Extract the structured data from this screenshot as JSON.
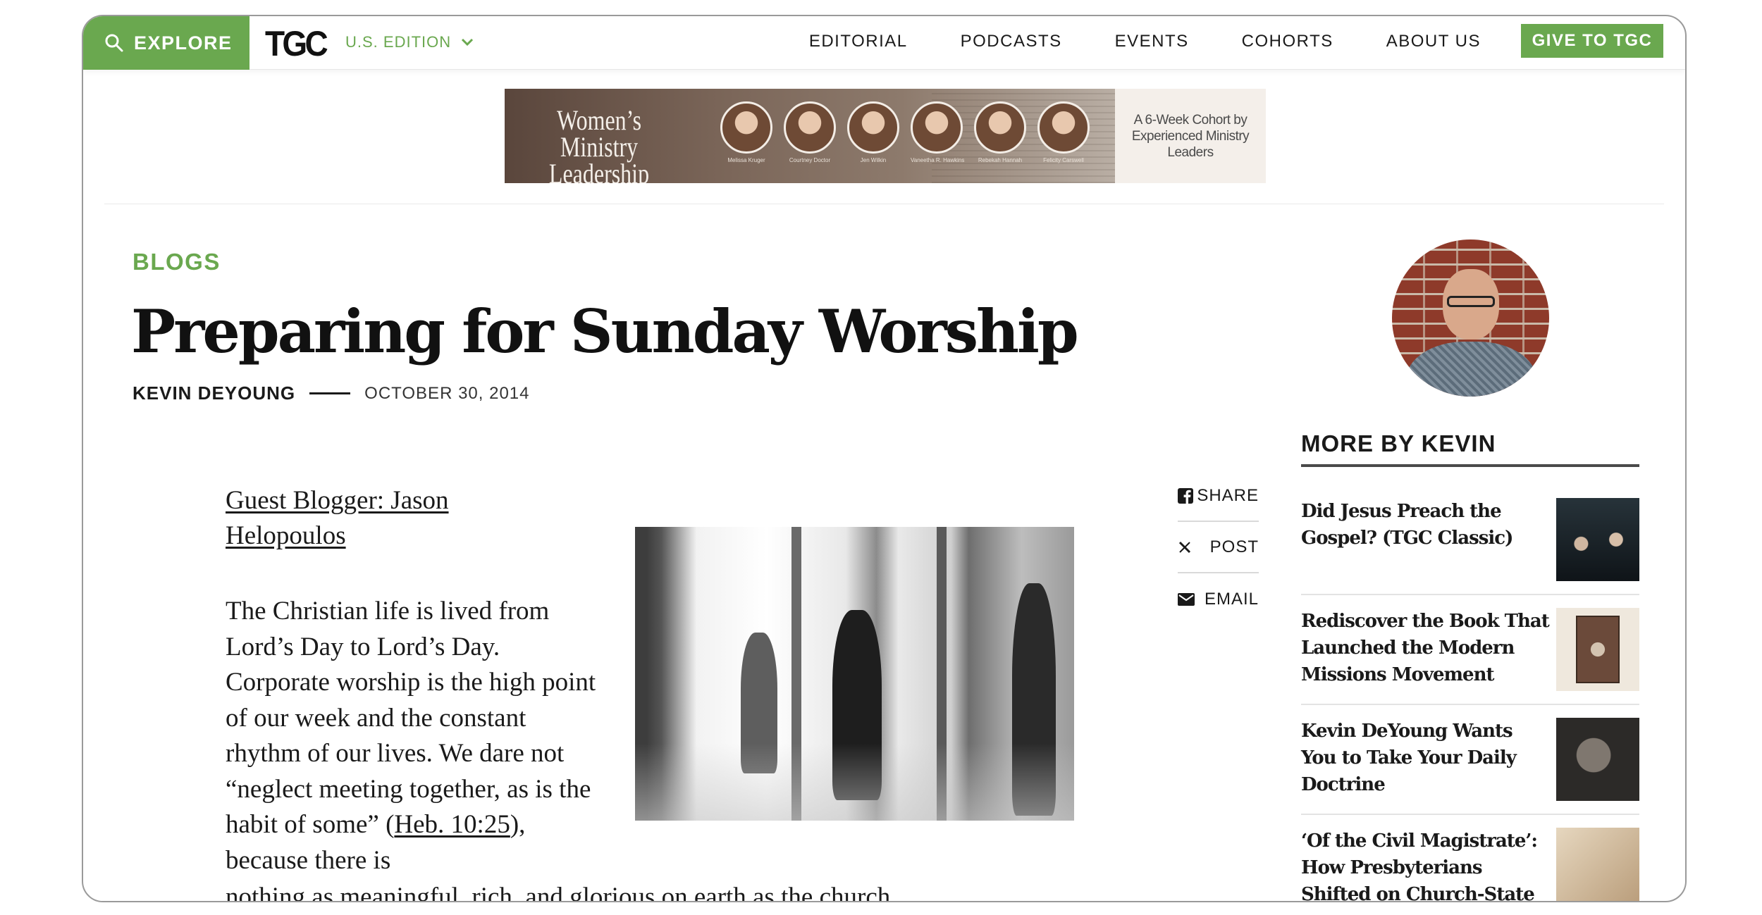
{
  "nav": {
    "explore": "EXPLORE",
    "logo": "TGC",
    "edition": "U.S. EDITION",
    "items": [
      "EDITORIAL",
      "PODCASTS",
      "EVENTS",
      "COHORTS",
      "ABOUT US"
    ],
    "give": "GIVE TO TGC"
  },
  "banner": {
    "title": "Women’s Ministry Leadership",
    "names": [
      "Melissa Kruger",
      "Courtney Doctor",
      "Jen Wilkin",
      "Vaneetha R. Hawkins",
      "Rebekah Hannah",
      "Felicity Carswell"
    ],
    "tagline": "A 6-Week Cohort by Experienced Ministry Leaders"
  },
  "article": {
    "kicker": "BLOGS",
    "title": "Preparing for Sunday Worship",
    "author": "KEVIN DEYOUNG",
    "date": "OCTOBER 30, 2014",
    "guest": "Guest Blogger: Jason Helopoulos",
    "body_before": "The Christian life is lived from Lord’s Day to Lord’s Day. Corporate worship is the high point of our week and the constant rhythm of our lives. We dare not “neglect meeting together, as is the habit of some” (",
    "body_link": "Heb. 10:25",
    "body_after": "), because there is",
    "body_last": "nothing as meaningful, rich, and glorious on earth as the church"
  },
  "share": {
    "share": "SHARE",
    "post": "POST",
    "email": "EMAIL"
  },
  "sidebar": {
    "heading": "MORE BY KEVIN",
    "items": [
      {
        "title": "Did Jesus Preach the Gospel? (TGC Classic)"
      },
      {
        "title": "Rediscover the Book That Launched the Modern Missions Movement"
      },
      {
        "title": "Kevin DeYoung Wants You to Take Your Daily Doctrine"
      },
      {
        "title": "‘Of the Civil Magistrate’: How Presbyterians Shifted on Church-State Relations"
      }
    ]
  },
  "colors": {
    "accent": "#6aa84f",
    "text": "#1a1a1a"
  }
}
